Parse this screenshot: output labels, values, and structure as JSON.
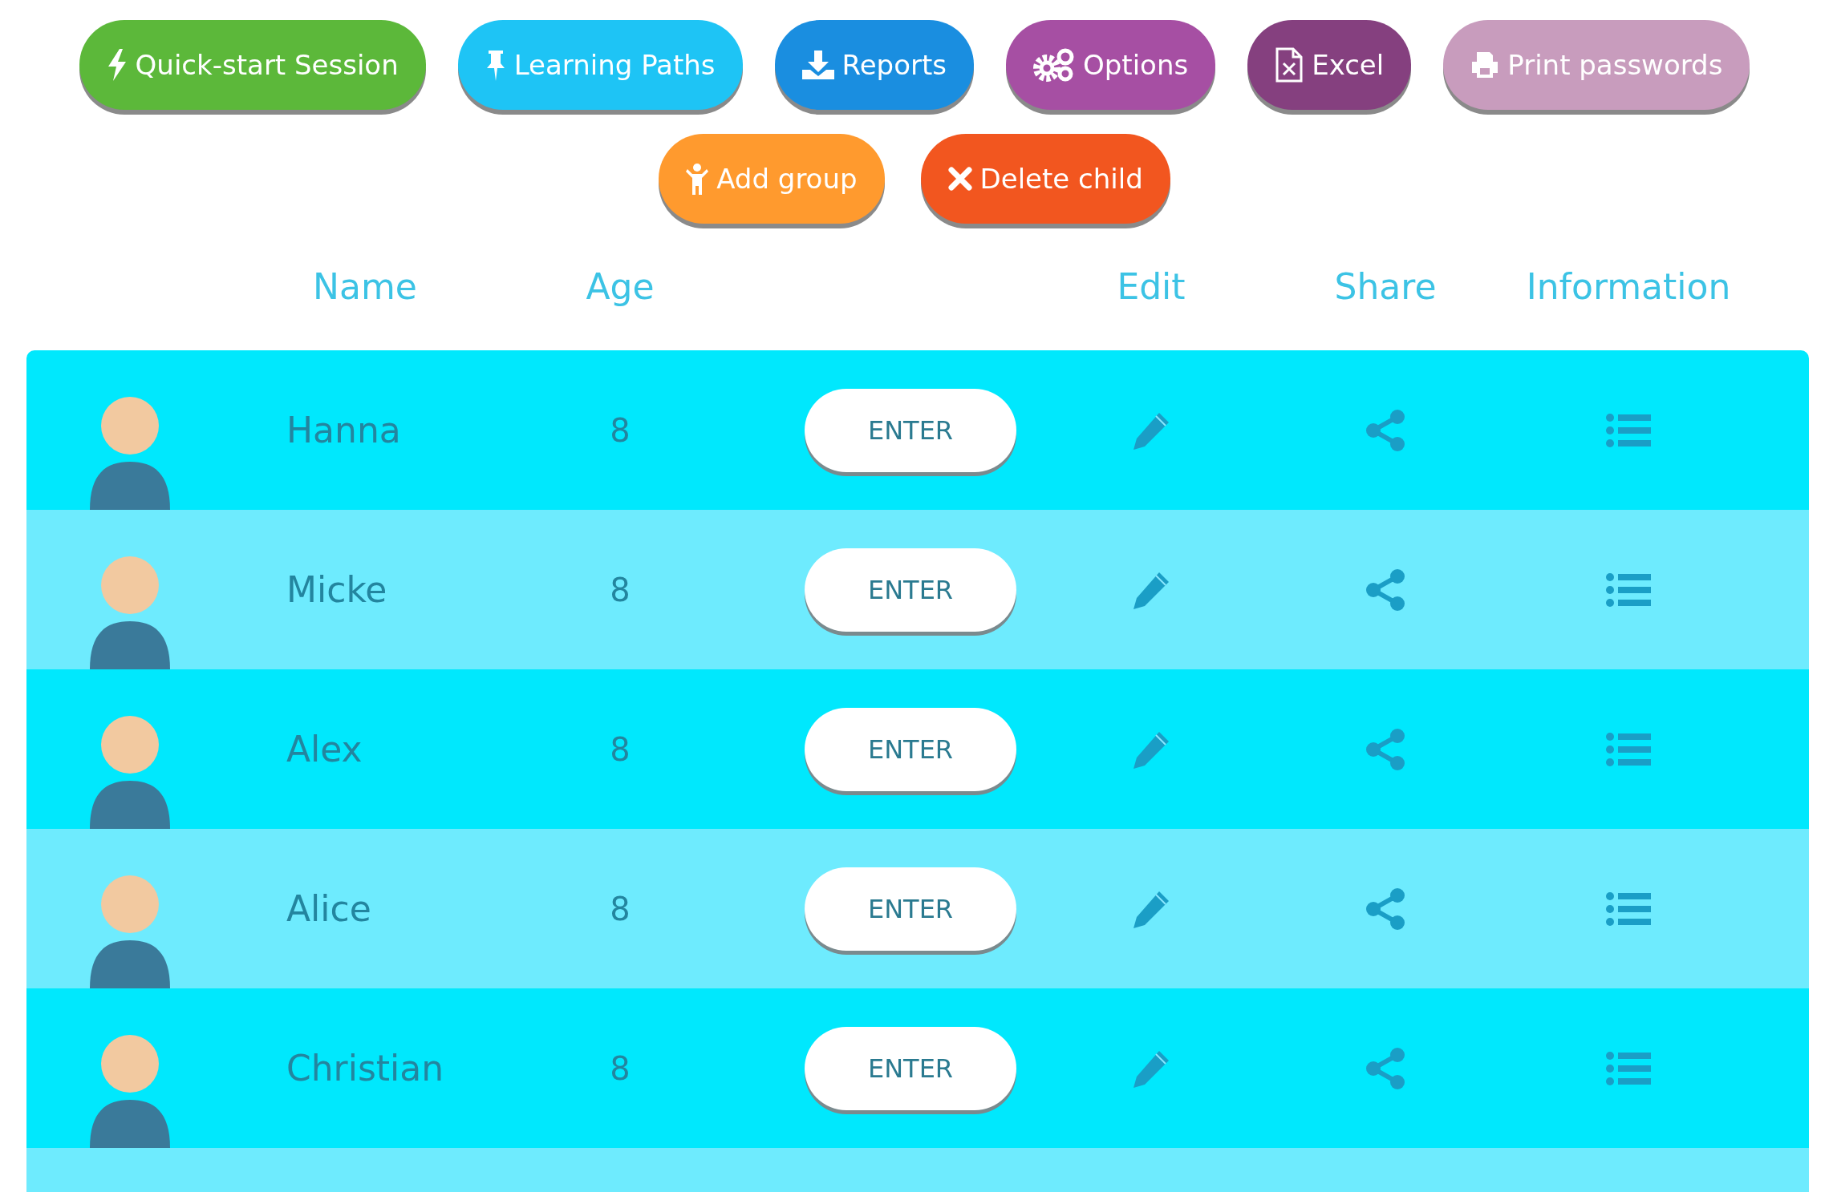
{
  "toolbar": [
    {
      "label": "Quick-start Session",
      "kind": "bolt",
      "color": "#5cb83a"
    },
    {
      "label": "Learning Paths",
      "kind": "pin",
      "color": "#1ec4f5"
    },
    {
      "label": "Reports",
      "kind": "download",
      "color": "#1a8ee0"
    },
    {
      "label": "Options",
      "kind": "gears",
      "color": "#a64fa3"
    },
    {
      "label": "Excel",
      "kind": "file",
      "color": "#85407f"
    },
    {
      "label": "Print passwords",
      "kind": "print",
      "color": "#c89cbd"
    }
  ],
  "actions": [
    {
      "label": "Add group",
      "kind": "child",
      "color": "#ff9a2e"
    },
    {
      "label": "Delete child",
      "kind": "cross",
      "color": "#f2561f"
    }
  ],
  "header": {
    "name": "Name",
    "age": "Age",
    "edit": "Edit",
    "share": "Share",
    "information": "Information"
  },
  "rows": [
    {
      "name": "Hanna",
      "age": "8",
      "enter": "ENTER"
    },
    {
      "name": "Micke",
      "age": "8",
      "enter": "ENTER"
    },
    {
      "name": "Alex",
      "age": "8",
      "enter": "ENTER"
    },
    {
      "name": "Alice",
      "age": "8",
      "enter": "ENTER"
    },
    {
      "name": "Christian",
      "age": "8",
      "enter": "ENTER"
    }
  ]
}
